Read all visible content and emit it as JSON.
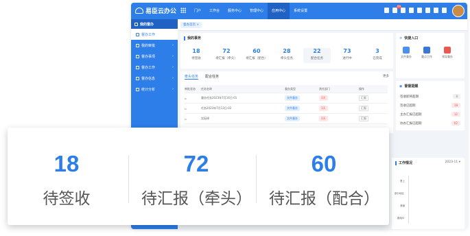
{
  "app": {
    "title": "易臣云办公"
  },
  "topnav": [
    "门户",
    "工作台",
    "服务中心",
    "管理中心",
    "应用中心",
    "系统设置"
  ],
  "topnav_active": 4,
  "notify_badge": "99",
  "sidebar": {
    "header": "我的督办",
    "items": [
      {
        "label": "督办工作"
      },
      {
        "label": "我的审批"
      },
      {
        "label": "督办事项"
      },
      {
        "label": "督办工作"
      },
      {
        "label": "督办信息"
      },
      {
        "label": "统计分析"
      }
    ]
  },
  "tab": {
    "label": "督办首页"
  },
  "todo": {
    "title": "我的事务",
    "stats": [
      {
        "value": "18",
        "label": "待签收"
      },
      {
        "value": "72",
        "label": "待汇报（牵头）"
      },
      {
        "value": "60",
        "label": "待汇报（配合）"
      },
      {
        "value": "28",
        "label": "牵头任务"
      },
      {
        "value": "22",
        "label": "配合任务"
      },
      {
        "value": "73",
        "label": "进行中"
      },
      {
        "value": "3",
        "label": "已完成"
      }
    ]
  },
  "tasks": {
    "tabs": [
      "牵头任务",
      "配合任务"
    ],
    "more": "更多",
    "columns": [
      "审批状态",
      "任务名称",
      "督办类型",
      "责任部门",
      "操作"
    ],
    "rows": [
      {
        "name": "督办任务2023年7月14日-01",
        "type": "文件督办",
        "dept": "3天",
        "action": "汇报"
      },
      {
        "name": "任务2023年7月13日-02",
        "type": "文件督办",
        "dept": "3天",
        "action": "汇报"
      },
      {
        "name": "实际掉",
        "type": "文件督办",
        "dept": "3天",
        "action": "汇报"
      }
    ]
  },
  "quick": {
    "title": "快捷入口",
    "items": [
      "文件督办",
      "重点工作",
      "领导督办"
    ]
  },
  "remind": {
    "title": "督督提醒",
    "rows": [
      {
        "label": "签收即将超期",
        "count": "8"
      },
      {
        "label": "签收已超期",
        "count": "18"
      },
      {
        "label": "主办汇报已超期",
        "count": "12"
      },
      {
        "label": "协办汇报已超期",
        "count": "62"
      }
    ]
  },
  "work": {
    "title": "工作情况",
    "period": "2023-11",
    "labels": [
      "督上",
      "部分地区",
      "港钢",
      "路地中"
    ]
  },
  "zoom": {
    "stats": [
      {
        "value": "18",
        "label": "待签收"
      },
      {
        "value": "72",
        "label": "待汇报（牵头）"
      },
      {
        "value": "60",
        "label": "待汇报（配合）"
      }
    ]
  }
}
